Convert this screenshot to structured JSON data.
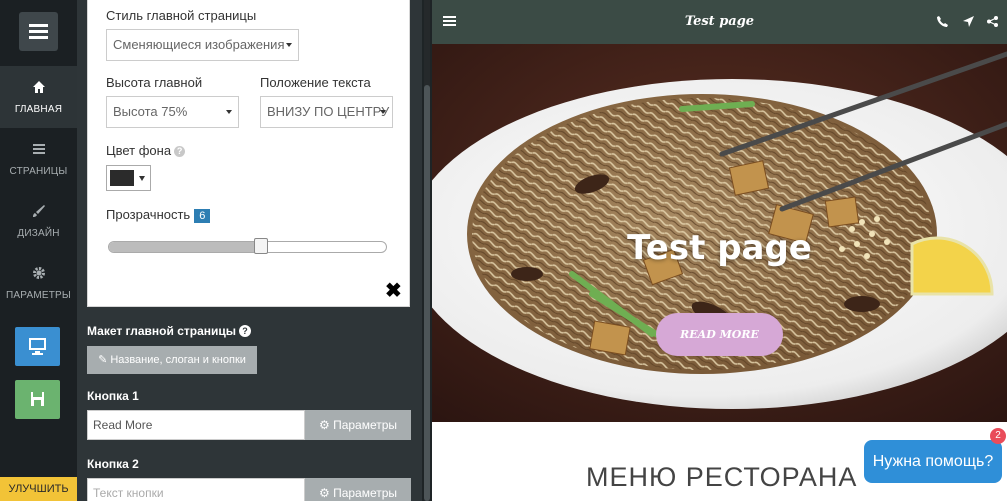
{
  "sidebar": {
    "items": [
      {
        "label": "ГЛАВНАЯ",
        "icon": "home-icon",
        "active": true
      },
      {
        "label": "СТРАНИЦЫ",
        "icon": "pages-icon",
        "active": false
      },
      {
        "label": "ДИЗАЙН",
        "icon": "brush-icon",
        "active": false
      },
      {
        "label": "ПАРАМЕТРЫ",
        "icon": "gear-icon",
        "active": false
      }
    ],
    "desktop_button_icon": "monitor-icon",
    "save_button_icon": "save-icon",
    "upgrade_label": "УЛУЧШИТЬ",
    "colors": {
      "accent_blue": "#3a8fd1",
      "save_green": "#6bb36f",
      "upgrade": "#f2c337"
    }
  },
  "settings": {
    "style_label": "Стиль главной страницы",
    "style_value": "Сменяющиеся изображения",
    "height_label": "Высота главной",
    "height_value": "Высота 75%",
    "text_position_label": "Положение текста",
    "text_position_value": "ВНИЗУ ПО ЦЕНТРУ",
    "bg_color_label": "Цвет фона",
    "bg_color_value": "#2b2b2b",
    "opacity_label": "Прозрачность",
    "opacity_value": "6",
    "opacity_fraction": 0.55,
    "close_label": "✖"
  },
  "layout_section": {
    "label": "Макет главной страницы",
    "button_label": "Название, слоган и кнопки"
  },
  "button1": {
    "label": "Кнопка 1",
    "value": "Read More",
    "params_label": "Параметры"
  },
  "button2": {
    "label": "Кнопка 2",
    "placeholder": "Текст кнопки",
    "params_label": "Параметры"
  },
  "preview": {
    "topbar_title": "Test page",
    "topbar_color": "#3b4b45",
    "hero_title": "Test page",
    "read_more_label": "READ MORE",
    "read_more_color": "#d6a8d6",
    "section_title": "МЕНЮ РЕСТОРАНА",
    "help_label": "Нужна помощь?",
    "help_badge": "2",
    "icons": [
      "menu-icon",
      "phone-icon",
      "location-icon",
      "share-icon"
    ]
  }
}
